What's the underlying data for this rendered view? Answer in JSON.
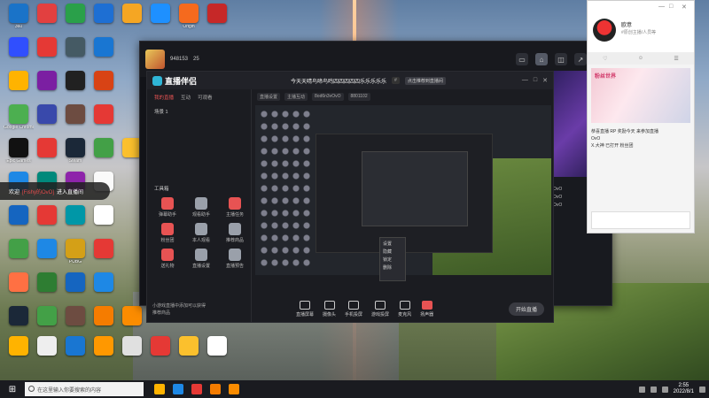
{
  "desktop": {
    "icons": [
      {
        "label": "360",
        "color": "#1a73c8",
        "col": 0,
        "row": 0
      },
      {
        "label": "",
        "color": "#e24040",
        "col": 1,
        "row": 0
      },
      {
        "label": "",
        "color": "#2aa04a",
        "col": 2,
        "row": 0
      },
      {
        "label": "",
        "color": "#1e6fd3",
        "col": 3,
        "row": 0
      },
      {
        "label": "",
        "color": "#f5a623",
        "col": 4,
        "row": 0
      },
      {
        "label": "",
        "color": "#1e90ff",
        "col": 5,
        "row": 0
      },
      {
        "label": "Origin",
        "color": "#f56a1e",
        "col": 6,
        "row": 0
      },
      {
        "label": "",
        "color": "#c62828",
        "col": 7,
        "row": 0
      },
      {
        "label": "",
        "color": "#304ffe",
        "col": 0,
        "row": 1
      },
      {
        "label": "",
        "color": "#e53935",
        "col": 1,
        "row": 1
      },
      {
        "label": "",
        "color": "#455a64",
        "col": 2,
        "row": 1
      },
      {
        "label": "",
        "color": "#1976d2",
        "col": 3,
        "row": 1
      },
      {
        "label": "",
        "color": "#ffb300",
        "col": 0,
        "row": 2
      },
      {
        "label": "",
        "color": "#7b1fa2",
        "col": 1,
        "row": 2
      },
      {
        "label": "",
        "color": "#212121",
        "col": 2,
        "row": 2
      },
      {
        "label": "",
        "color": "#d84315",
        "col": 3,
        "row": 2
      },
      {
        "label": "Google Chrome",
        "color": "#4caf50",
        "col": 0,
        "row": 3
      },
      {
        "label": "",
        "color": "#3949ab",
        "col": 1,
        "row": 3
      },
      {
        "label": "",
        "color": "#6d4c41",
        "col": 2,
        "row": 3
      },
      {
        "label": "",
        "color": "#e53935",
        "col": 3,
        "row": 3
      },
      {
        "label": "Epic Games",
        "color": "#111111",
        "col": 0,
        "row": 4
      },
      {
        "label": "",
        "color": "#e53935",
        "col": 1,
        "row": 4
      },
      {
        "label": "Steam",
        "color": "#1b2838",
        "col": 2,
        "row": 4
      },
      {
        "label": "",
        "color": "#43a047",
        "col": 3,
        "row": 4
      },
      {
        "label": "",
        "color": "#fbc02d",
        "col": 4,
        "row": 4
      },
      {
        "label": "",
        "color": "#1e88e5",
        "col": 0,
        "row": 5
      },
      {
        "label": "",
        "color": "#00897b",
        "col": 1,
        "row": 5
      },
      {
        "label": "",
        "color": "#8e24aa",
        "col": 2,
        "row": 5
      },
      {
        "label": "",
        "color": "#fafafa",
        "col": 3,
        "row": 5
      },
      {
        "label": "",
        "color": "#1565c0",
        "col": 0,
        "row": 6
      },
      {
        "label": "",
        "color": "#e53935",
        "col": 1,
        "row": 6
      },
      {
        "label": "",
        "color": "#0097a7",
        "col": 2,
        "row": 6
      },
      {
        "label": "",
        "color": "#ffffff",
        "col": 3,
        "row": 6
      },
      {
        "label": "",
        "color": "#43a047",
        "col": 0,
        "row": 7
      },
      {
        "label": "",
        "color": "#1e88e5",
        "col": 1,
        "row": 7
      },
      {
        "label": "PUBG",
        "color": "#d4a017",
        "col": 2,
        "row": 7
      },
      {
        "label": "",
        "color": "#e53935",
        "col": 3,
        "row": 7
      },
      {
        "label": "",
        "color": "#ff7043",
        "col": 0,
        "row": 8
      },
      {
        "label": "",
        "color": "#2e7d32",
        "col": 1,
        "row": 8
      },
      {
        "label": "",
        "color": "#1565c0",
        "col": 2,
        "row": 8
      },
      {
        "label": "",
        "color": "#1e88e5",
        "col": 3,
        "row": 8
      },
      {
        "label": "",
        "color": "#1b2838",
        "col": 0,
        "row": 9
      },
      {
        "label": "",
        "color": "#43a047",
        "col": 1,
        "row": 9
      },
      {
        "label": "",
        "color": "#6d4c41",
        "col": 2,
        "row": 9
      },
      {
        "label": "",
        "color": "#f57c00",
        "col": 3,
        "row": 9
      },
      {
        "label": "",
        "color": "#fb8c00",
        "col": 4,
        "row": 9
      },
      {
        "label": "",
        "color": "#ffb300",
        "col": 0,
        "row": 10
      },
      {
        "label": "",
        "color": "#eeeeee",
        "col": 1,
        "row": 10
      },
      {
        "label": "",
        "color": "#1976d2",
        "col": 2,
        "row": 10
      },
      {
        "label": "",
        "color": "#ff9800",
        "col": 3,
        "row": 10
      },
      {
        "label": "",
        "color": "#e0e0e0",
        "col": 4,
        "row": 10
      },
      {
        "label": "",
        "color": "#e53935",
        "col": 5,
        "row": 10
      },
      {
        "label": "",
        "color": "#fbc02d",
        "col": 6,
        "row": 10
      },
      {
        "label": "",
        "color": "#ffffff",
        "col": 7,
        "row": 10
      }
    ]
  },
  "notification": {
    "prefix": "欢迎",
    "user": "[Fishy的OvO]",
    "suffix": "进入直播间"
  },
  "live_window": {
    "viewers": "948153",
    "likes": "25"
  },
  "app": {
    "name": "直播伴侣",
    "title": "今天天晴鸟啼鸟鸣四四四四四乐乐乐乐乐",
    "tag_prefix": "#",
    "hint": "点击推荐到直播间",
    "tabs": [
      "我的直播",
      "互动",
      "可观看"
    ],
    "scene": "场景 1",
    "tools_title": "工具箱",
    "tools": [
      {
        "label": "弹幕助手",
        "color": "#e75353"
      },
      {
        "label": "观看助手",
        "color": "#9aa0aa"
      },
      {
        "label": "主播任务",
        "color": "#e75353"
      },
      {
        "label": "粉丝团",
        "color": "#e75353"
      },
      {
        "label": "本人观看",
        "color": "#9aa0aa"
      },
      {
        "label": "推荐商品",
        "color": "#9aa0aa"
      },
      {
        "label": "送礼物",
        "color": "#e75353"
      },
      {
        "label": "直播设置",
        "color": "#9aa0aa"
      },
      {
        "label": "直播预告",
        "color": "#9aa0aa"
      }
    ],
    "side_notes": [
      "小游戏直播中添加可以获得",
      "推荐商品"
    ],
    "meta": [
      "直播设置",
      "主播互动",
      "8od6n3vOvO",
      "8801102"
    ],
    "bottom_tools": [
      "直播屏幕",
      "摄像头",
      "手机投屏",
      "游戏投屏",
      "麦克风",
      "扬声器"
    ],
    "start_label": "开始直播",
    "context_menu": [
      "设置",
      "隐藏",
      "锁定",
      "删除"
    ]
  },
  "chat": {
    "name": "欧意",
    "subtitle": "#原创主播/人员等",
    "banner_title": "粉丝世界",
    "messages": [
      "恭喜直播 RP 奖励今天 来参加直播",
      "OvO",
      "X.大神 已打开 粉丝团"
    ]
  },
  "taskbar": {
    "search_placeholder": "在这里输入你要搜索的内容",
    "time": "2:55",
    "date": "2022/8/1",
    "app_colors": [
      "#ffb300",
      "#1e88e5",
      "#e53935",
      "#f57c00",
      "#fb8c00"
    ]
  }
}
